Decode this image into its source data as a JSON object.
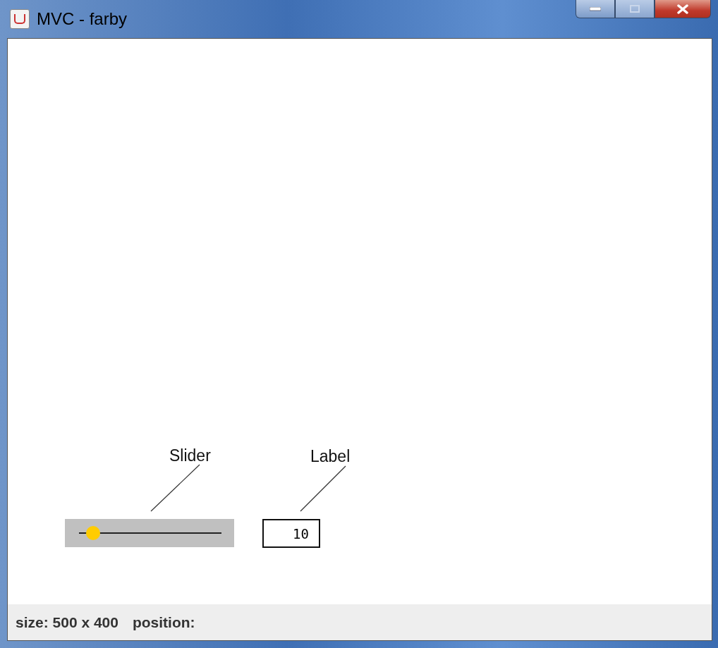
{
  "window": {
    "title": "MVC - farby"
  },
  "canvas": {
    "slider": {
      "caption": "Slider",
      "level": 0.1
    },
    "label": {
      "caption": "Label",
      "value": "10"
    }
  },
  "status_bar": {
    "size": "size: 500 x 400",
    "position": "position:"
  }
}
